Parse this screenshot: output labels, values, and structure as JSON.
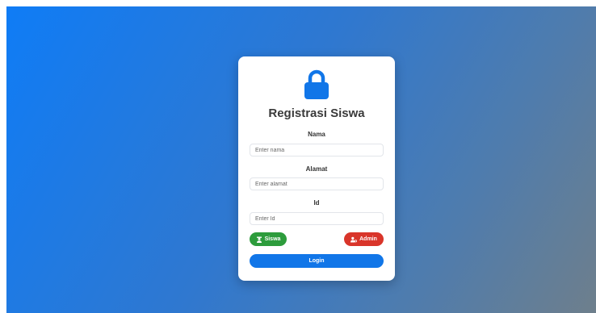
{
  "form": {
    "title": "Registrasi Siswa",
    "fields": [
      {
        "label": "Nama",
        "placeholder": "Enter nama",
        "value": ""
      },
      {
        "label": "Alamat",
        "placeholder": "Enter alamat",
        "value": ""
      },
      {
        "label": "Id",
        "placeholder": "Enter Id",
        "value": ""
      }
    ],
    "roles": {
      "siswa_label": "Siswa",
      "admin_label": "Admin"
    },
    "login_label": "Login"
  },
  "icons": {
    "header": "lock-icon",
    "siswa": "user-graduate-icon",
    "admin": "users-cog-icon"
  },
  "colors": {
    "accent": "#1176e8",
    "siswa": "#2d9c3c",
    "admin": "#d9352a",
    "background_start": "#0f7cf6",
    "background_end": "#6e7f8c"
  }
}
